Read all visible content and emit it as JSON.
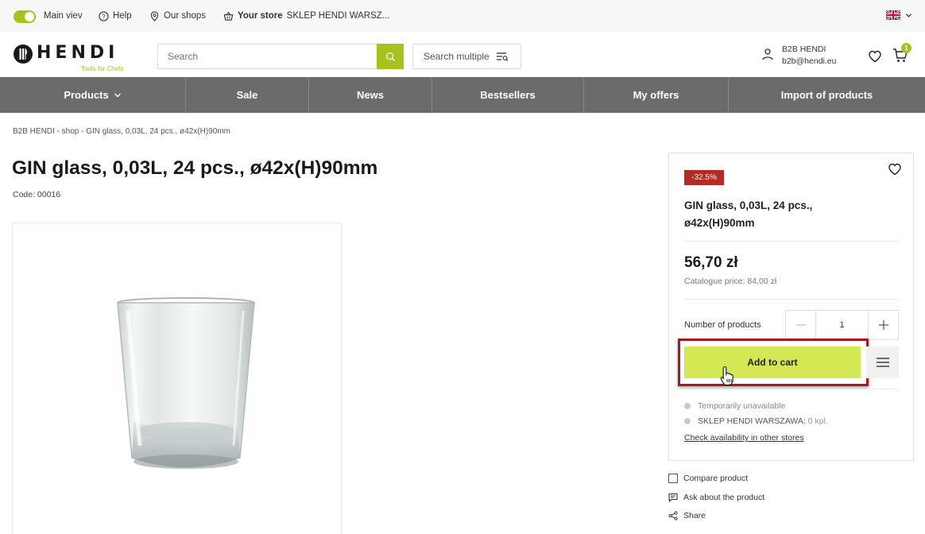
{
  "topbar": {
    "main_view": "Main viev",
    "help": "Help",
    "our_shops": "Our shops",
    "store_label": "Your store",
    "store_name": "SKLEP HENDI WARSZ...",
    "language_icon": "uk-flag-icon"
  },
  "header": {
    "logo_text": "HENDI",
    "logo_tagline": "Tools for Chefs",
    "search_placeholder": "Search",
    "search_multiple": "Search multiple",
    "account_name": "B2B HENDI",
    "account_email": "b2b@hendi.eu",
    "cart_count": "1"
  },
  "nav": {
    "items": [
      {
        "label": "Products"
      },
      {
        "label": "Sale"
      },
      {
        "label": "News"
      },
      {
        "label": "Bestsellers"
      },
      {
        "label": "My offers"
      },
      {
        "label": "Import of products"
      }
    ]
  },
  "breadcrumb": "B2B HENDI  -  shop  -  GIN glass, 0,03L, 24 pcs., ø42x(H)90mm",
  "product": {
    "title": "GIN glass, 0,03L, 24 pcs., ø42x(H)90mm",
    "code": "Code: 00016"
  },
  "panel": {
    "discount": "-32.5%",
    "name": "GIN glass, 0,03L, 24 pcs., ø42x(H)90mm",
    "price": "56,70 zł",
    "catalogue_price": "Catalogue price: 84,00 zł",
    "qty_label": "Number of products",
    "qty_value": "1",
    "add_to_cart": "Add to cart",
    "availability": "Temporarily unavailable",
    "store_stock_label": "SKLEP HENDI WARSZAWA:",
    "store_stock_value": "0 kpl.",
    "check_link": "Check availability in other stores"
  },
  "extras": {
    "compare": "Compare product",
    "ask": "Ask about the product",
    "share": "Share"
  },
  "colors": {
    "brand_green": "#a9c11c",
    "cart_button": "#d4e853",
    "nav_bg": "#6b6b6b",
    "discount_red": "#b52a22"
  }
}
